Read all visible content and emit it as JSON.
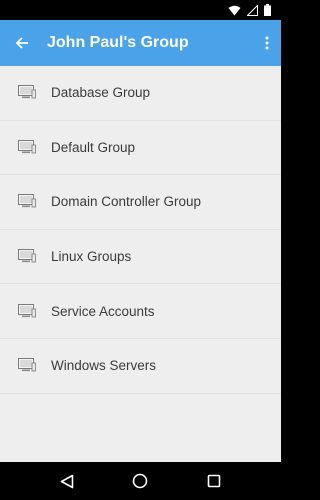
{
  "app_bar": {
    "title": "John Paul's Group",
    "color": "#4aa3e8"
  },
  "icons": {
    "back": "arrow-back-icon",
    "overflow": "more-vert-icon",
    "item": "computer-monitor-icon",
    "wifi": "wifi-icon",
    "signal": "signal-icon",
    "battery": "battery-icon",
    "nav_back": "triangle-back-icon",
    "nav_home": "circle-home-icon",
    "nav_recents": "square-recents-icon"
  },
  "groups": [
    {
      "label": "Database Group"
    },
    {
      "label": "Default Group"
    },
    {
      "label": "Domain Controller Group"
    },
    {
      "label": "Linux Groups"
    },
    {
      "label": "Service Accounts"
    },
    {
      "label": "Windows Servers"
    }
  ]
}
